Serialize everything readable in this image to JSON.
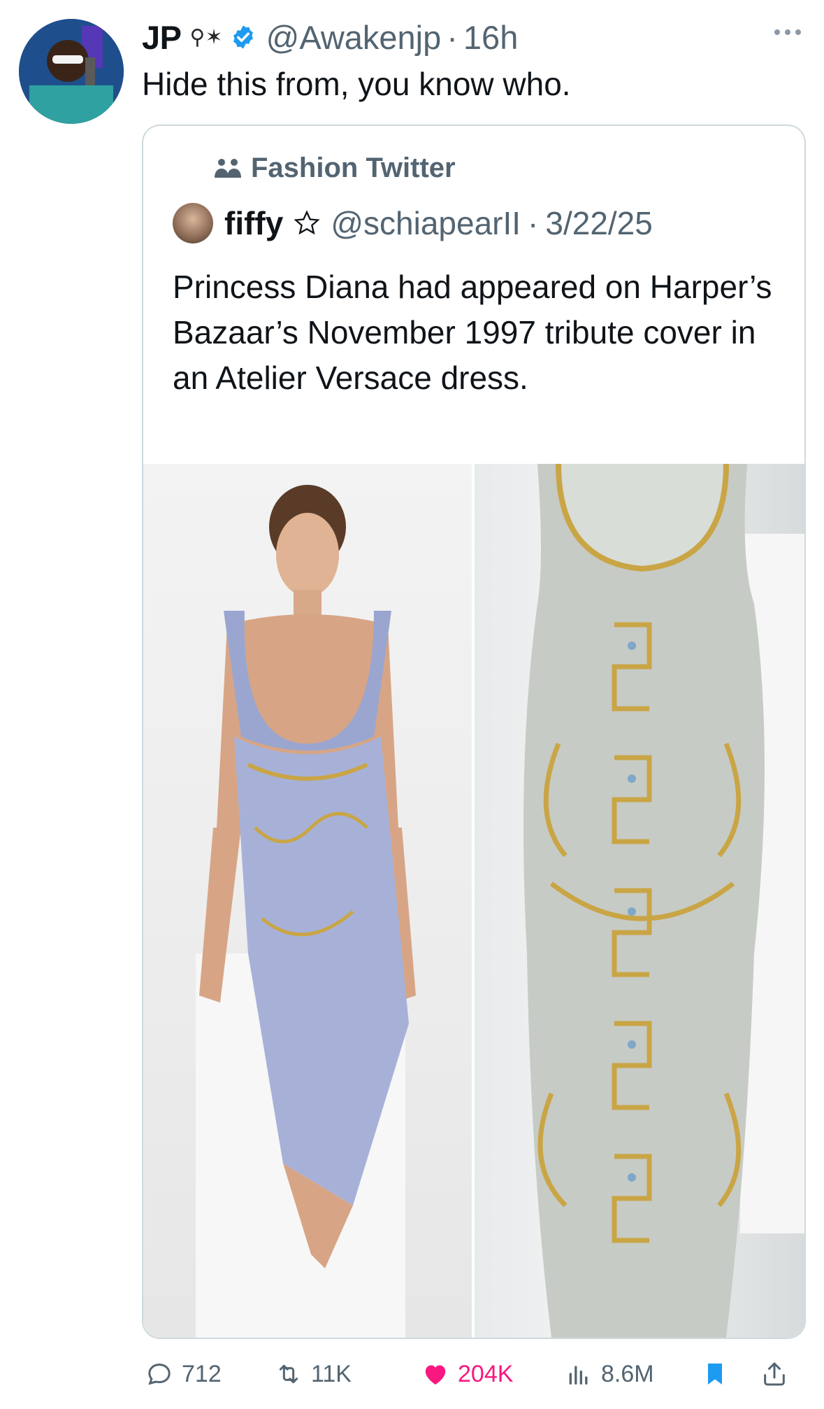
{
  "tweet": {
    "author_name": "JP",
    "author_emoji": "⚲✶",
    "handle": "@Awakenjp",
    "separator": "·",
    "time": "16h",
    "text": "Hide this from, you know who."
  },
  "quote": {
    "community": "Fashion Twitter",
    "author_name": "fiffy",
    "handle": "@schiapearII",
    "separator": "·",
    "date": "3/22/25",
    "text": "Princess Diana had appeared on Harper’s Bazaar’s November 1997 tribute cover in an Atelier Versace dress."
  },
  "actions": {
    "replies": "712",
    "reposts": "11K",
    "likes": "204K",
    "views": "8.6M"
  },
  "colors": {
    "secondary_text": "#536471",
    "verified": "#1d9bf0",
    "like": "#f91880",
    "bookmark": "#1d9bf0",
    "border": "#cfd9de"
  },
  "icons": [
    "more-icon",
    "verified-icon",
    "community-icon",
    "star-icon",
    "reply-icon",
    "retweet-icon",
    "heart-icon",
    "views-icon",
    "bookmark-icon",
    "share-icon"
  ]
}
